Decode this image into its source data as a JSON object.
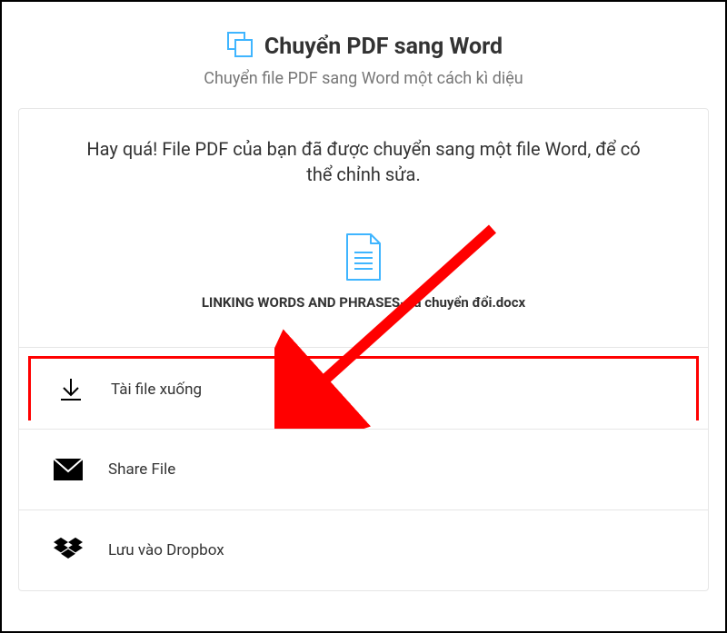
{
  "header": {
    "title": "Chuyển PDF sang Word",
    "subtitle": "Chuyển file PDF sang Word một cách kì diệu"
  },
  "success": {
    "message": "Hay quá! File PDF của bạn đã được chuyển sang một file Word, để có thể chỉnh sửa.",
    "filename": "LINKING WORDS AND PHRASES-đã chuyển đổi.docx"
  },
  "actions": {
    "download": "Tài file xuống",
    "share": "Share File",
    "dropbox": "Lưu vào Dropbox"
  },
  "colors": {
    "accent": "#3fb5ff",
    "highlight": "#ff0000"
  }
}
